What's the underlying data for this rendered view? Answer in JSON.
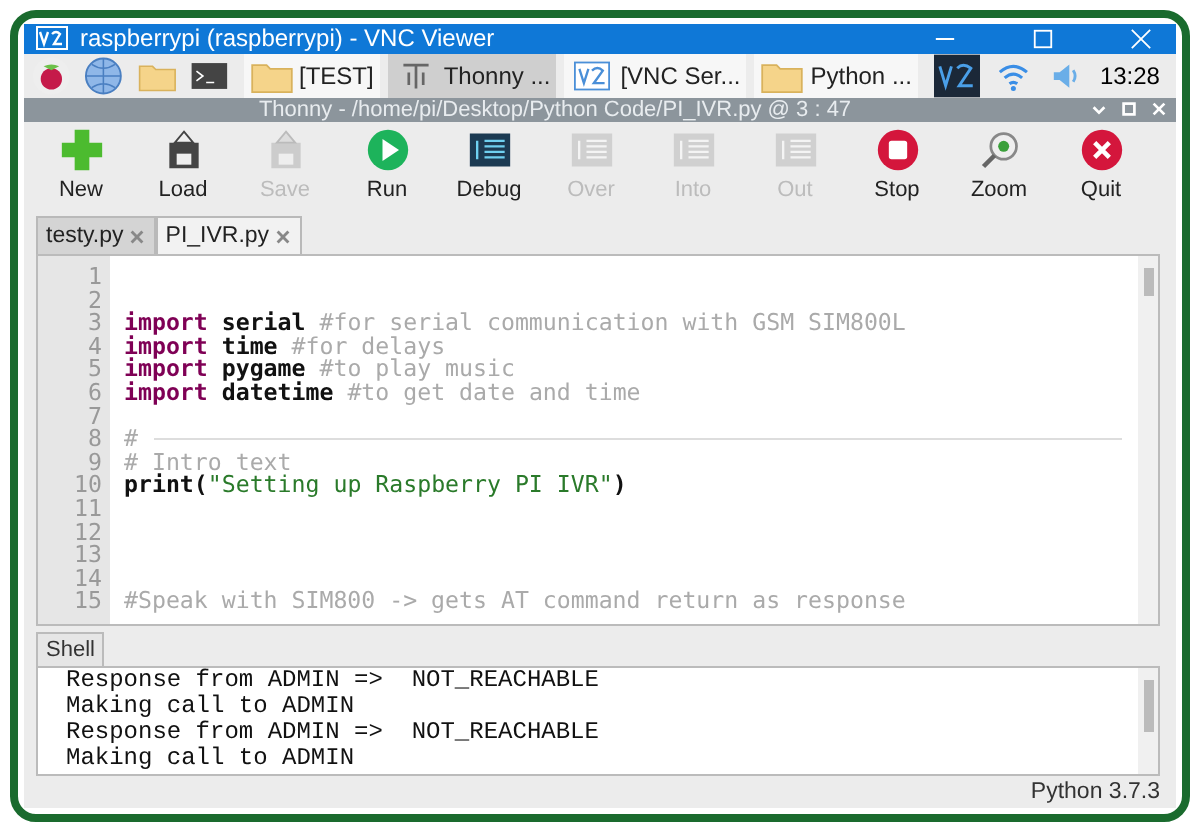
{
  "vnc_window": {
    "title": "raspberrypi (raspberrypi) - VNC Viewer"
  },
  "taskbar": {
    "tasks": [
      {
        "label": "[TEST]",
        "kind": "folder",
        "selected": false
      },
      {
        "label": "Thonny  ...",
        "kind": "thonny",
        "selected": true
      },
      {
        "label": "[VNC Ser...",
        "kind": "vnc",
        "selected": false
      },
      {
        "label": "Python  ...",
        "kind": "folder",
        "selected": false
      }
    ],
    "clock": "13:28"
  },
  "thonny_window": {
    "title": "Thonny  -  /home/pi/Desktop/Python Code/PI_IVR.py  @  3 : 47"
  },
  "toolbar": [
    {
      "label": "New",
      "kind": "new",
      "disabled": false
    },
    {
      "label": "Load",
      "kind": "load",
      "disabled": false
    },
    {
      "label": "Save",
      "kind": "load",
      "disabled": true
    },
    {
      "label": "Run",
      "kind": "run",
      "disabled": false
    },
    {
      "label": "Debug",
      "kind": "debug",
      "disabled": false
    },
    {
      "label": "Over",
      "kind": "debug",
      "disabled": true
    },
    {
      "label": "Into",
      "kind": "debug",
      "disabled": true
    },
    {
      "label": "Out",
      "kind": "debug",
      "disabled": true
    },
    {
      "label": "Stop",
      "kind": "stop",
      "disabled": false
    },
    {
      "label": "Zoom",
      "kind": "zoom",
      "disabled": false
    },
    {
      "label": "Quit",
      "kind": "quit",
      "disabled": false
    }
  ],
  "tabs": [
    {
      "label": "testy.py",
      "selected": false
    },
    {
      "label": "PI_IVR.py",
      "selected": true
    }
  ],
  "editor": {
    "lines": [
      {
        "number": "1",
        "kind": "code"
      },
      {
        "number": "2",
        "kind": "code"
      },
      {
        "number": "3",
        "kind": "code",
        "segments": [
          {
            "text": "import",
            "kind": "keyword"
          },
          {
            "text": " serial ",
            "kind": "name"
          },
          {
            "text": "#for serial communication with GSM SIM800L",
            "kind": "comment"
          }
        ]
      },
      {
        "number": "4",
        "kind": "code",
        "segments": [
          {
            "text": "import",
            "kind": "keyword"
          },
          {
            "text": " time ",
            "kind": "name"
          },
          {
            "text": "#for delays",
            "kind": "comment"
          }
        ]
      },
      {
        "number": "5",
        "kind": "code",
        "segments": [
          {
            "text": "import",
            "kind": "keyword"
          },
          {
            "text": " pygame ",
            "kind": "name"
          },
          {
            "text": "#to play music",
            "kind": "comment"
          }
        ]
      },
      {
        "number": "6",
        "kind": "code",
        "segments": [
          {
            "text": "import",
            "kind": "keyword"
          },
          {
            "text": " datetime ",
            "kind": "name"
          },
          {
            "text": "#to get date and time",
            "kind": "comment"
          }
        ]
      },
      {
        "number": "7",
        "kind": "code"
      },
      {
        "number": "8",
        "kind": "separator",
        "segments": [
          {
            "text": "#",
            "kind": "comment"
          }
        ]
      },
      {
        "number": "9",
        "kind": "code",
        "segments": [
          {
            "text": "# Intro text",
            "kind": "comment"
          }
        ]
      },
      {
        "number": "10",
        "kind": "code",
        "segments": [
          {
            "text": "print(",
            "kind": "name"
          },
          {
            "text": "\"Setting up Raspberry PI IVR\"",
            "kind": "string"
          },
          {
            "text": ")",
            "kind": "name"
          }
        ]
      },
      {
        "number": "11",
        "kind": "code"
      },
      {
        "number": "12",
        "kind": "code"
      },
      {
        "number": "13",
        "kind": "code"
      },
      {
        "number": "14",
        "kind": "code"
      },
      {
        "number": "15",
        "kind": "code",
        "segments": [
          {
            "text": "#Speak with SIM800 -> gets AT command return as response",
            "kind": "comment"
          }
        ]
      }
    ]
  },
  "shell": {
    "tab": "Shell",
    "lines": [
      "Response from ADMIN =>  NOT_REACHABLE",
      "Making call to ADMIN",
      "Response from ADMIN =>  NOT_REACHABLE",
      "Making call to ADMIN"
    ]
  },
  "status_bar": "Python 3.7.3"
}
